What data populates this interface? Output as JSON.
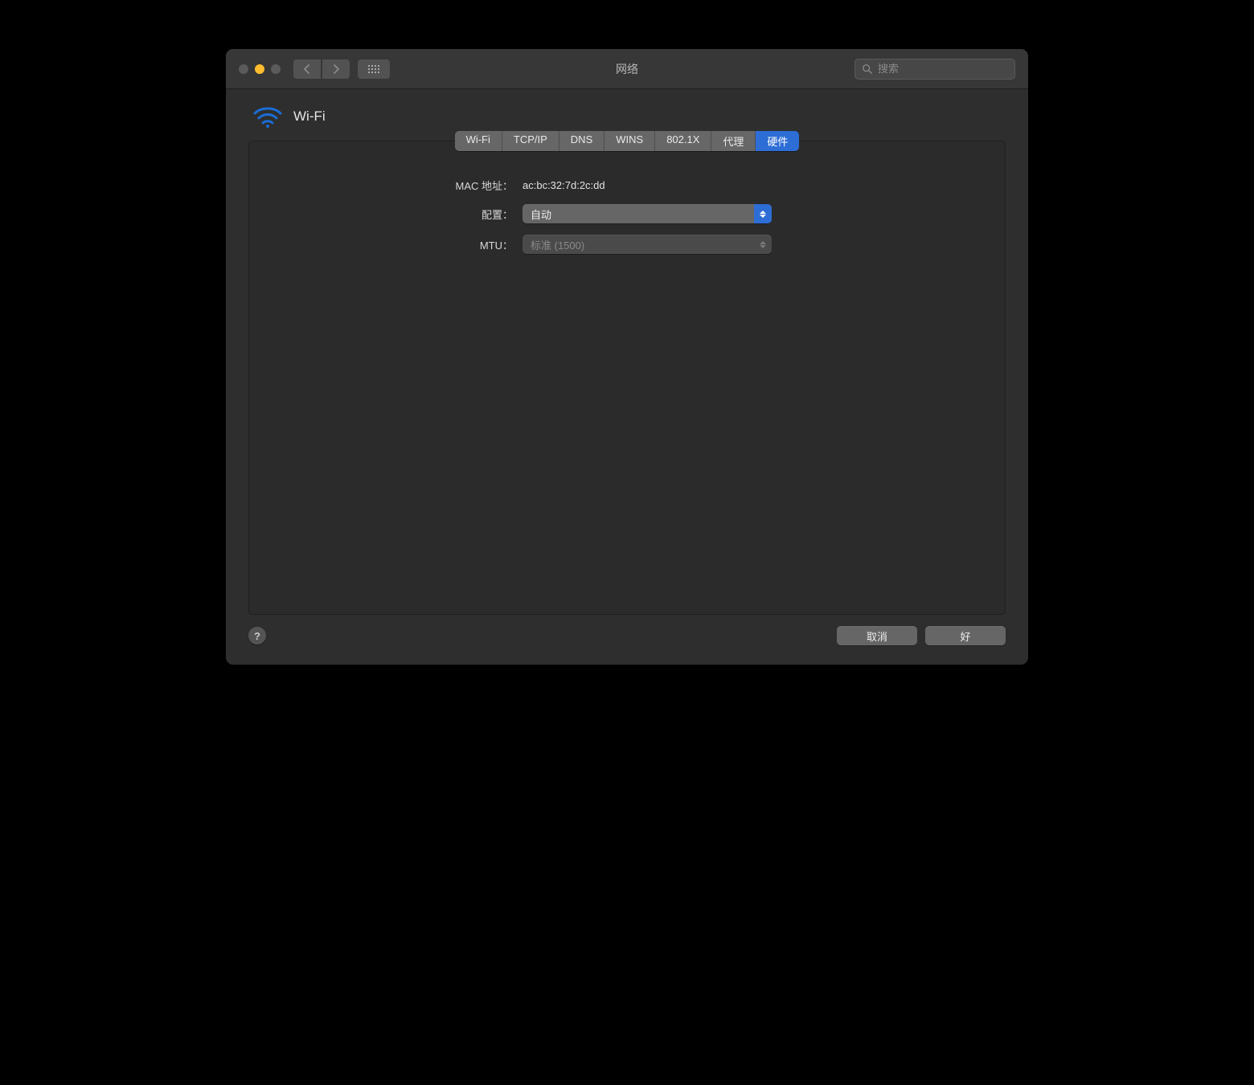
{
  "titlebar": {
    "title": "网络",
    "search_placeholder": "搜索"
  },
  "header": {
    "title": "Wi-Fi"
  },
  "tabs": [
    {
      "label": "Wi-Fi",
      "active": false
    },
    {
      "label": "TCP/IP",
      "active": false
    },
    {
      "label": "DNS",
      "active": false
    },
    {
      "label": "WINS",
      "active": false
    },
    {
      "label": "802.1X",
      "active": false
    },
    {
      "label": "代理",
      "active": false
    },
    {
      "label": "硬件",
      "active": true
    }
  ],
  "form": {
    "mac_label": "MAC 地址：",
    "mac_value": "ac:bc:32:7d:2c:dd",
    "config_label": "配置：",
    "config_value": "自动",
    "mtu_label": "MTU：",
    "mtu_value": "标准 (1500)"
  },
  "footer": {
    "help": "?",
    "cancel": "取消",
    "ok": "好"
  }
}
